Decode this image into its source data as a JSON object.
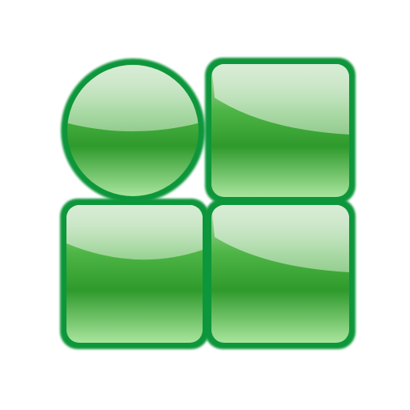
{
  "icon": {
    "name": "shapes-grid-icon",
    "tiles": [
      {
        "shape": "circle"
      },
      {
        "shape": "rounded-square"
      },
      {
        "shape": "rounded-square"
      },
      {
        "shape": "rounded-square"
      }
    ],
    "colors": {
      "border": "#11963a",
      "fill_dark": "#2f9a2c",
      "fill_mid": "#4db545",
      "fill_light": "#b9dfb5",
      "highlight_top": "#d9ecd6",
      "glow": "#a9e59e",
      "background": "#ffffff"
    }
  }
}
